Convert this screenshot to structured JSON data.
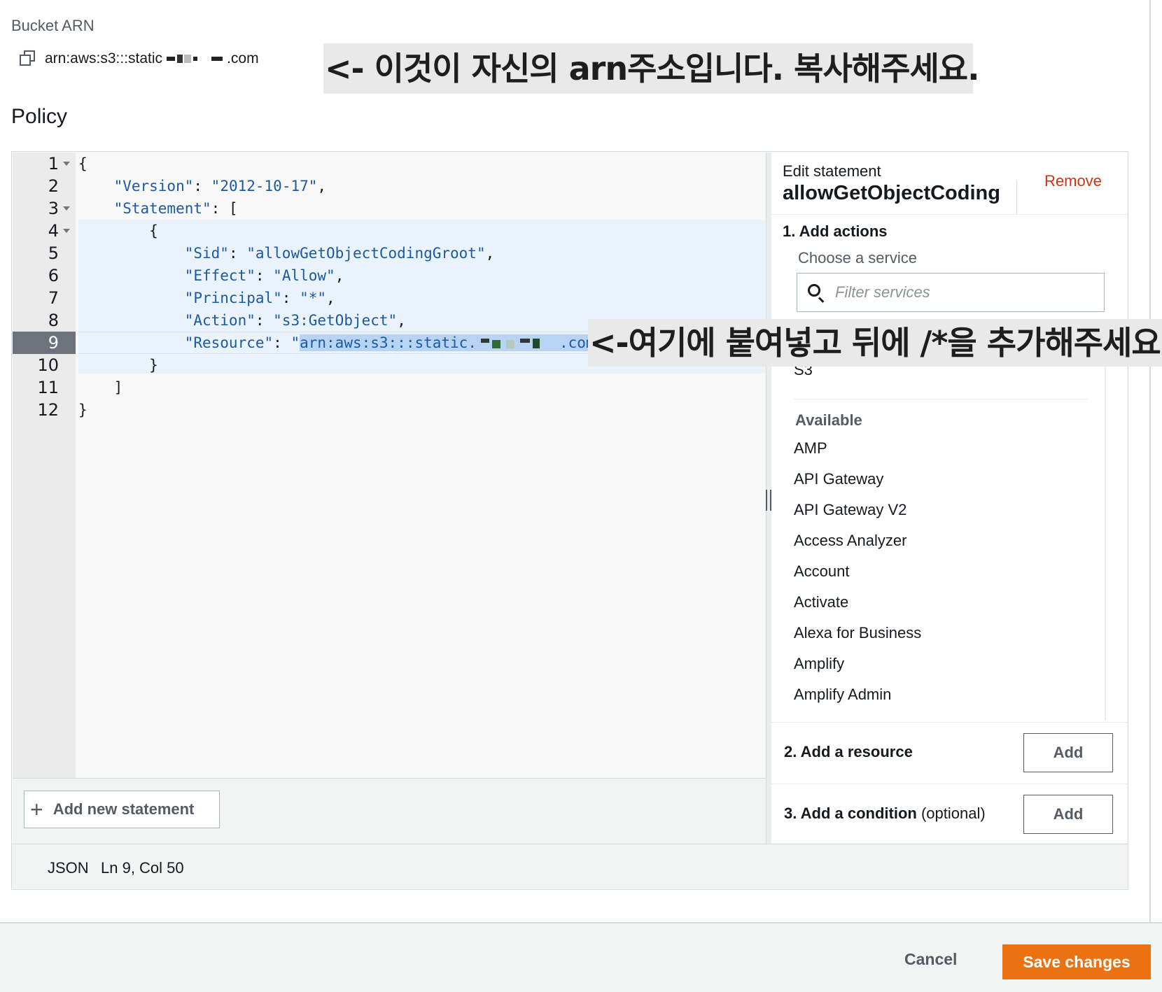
{
  "bucket_arn": {
    "label": "Bucket ARN",
    "value_prefix": "arn:aws:s3:::static",
    "value_suffix": ".com"
  },
  "annotations": {
    "copy_hint": "<- 이것이 자신의 arn주소입니다. 복사해주세요.",
    "paste_hint": "<-여기에 붙여넣고 뒤에 /*을 추가해주세요"
  },
  "policy": {
    "title": "Policy",
    "line_numbers": [
      "1",
      "2",
      "3",
      "4",
      "5",
      "6",
      "7",
      "8",
      "9",
      "10",
      "11",
      "12"
    ],
    "code": {
      "l1": "{",
      "l2_key": "\"Version\"",
      "l2_val": "\"2012-10-17\"",
      "l3_key": "\"Statement\"",
      "l3_rest": "[",
      "l4": "{",
      "l5_key": "\"Sid\"",
      "l5_val": "\"allowGetObjectCodingGroot\"",
      "l6_key": "\"Effect\"",
      "l6_val": "\"Allow\"",
      "l7_key": "\"Principal\"",
      "l7_val": "\"*\"",
      "l8_key": "\"Action\"",
      "l8_val": "\"s3:GetObject\"",
      "l9_key": "\"Resource\"",
      "l9_quote": "\"",
      "l9_selected_prefix": "arn:aws:s3:::static.",
      "l9_selected_suffix": ".com",
      "l9_tail": "/*\"",
      "l10": "}",
      "l11": "]",
      "l12": "}"
    },
    "add_statement_label": "Add new statement"
  },
  "side_panel": {
    "edit_statement_label": "Edit statement",
    "statement_name": "allowGetObjectCoding",
    "remove_label": "Remove",
    "step1_label": "1. Add actions",
    "choose_service_label": "Choose a service",
    "filter_placeholder": "Filter services",
    "selected_service_partial": "S3",
    "available_header": "Available",
    "services": [
      "AMP",
      "API Gateway",
      "API Gateway V2",
      "Access Analyzer",
      "Account",
      "Activate",
      "Alexa for Business",
      "Amplify",
      "Amplify Admin"
    ],
    "step2_label": "2. Add a resource",
    "step2_button": "Add",
    "step3_label_bold": "3. Add a condition",
    "step3_label_optional": " (optional)",
    "step3_button": "Add"
  },
  "status_bar": {
    "language": "JSON",
    "position": "Ln 9, Col 50"
  },
  "footer": {
    "cancel_label": "Cancel",
    "save_label": "Save changes"
  },
  "colors": {
    "primary_button": "#ec7211",
    "remove_link": "#d13212",
    "json_string": "#1a5aa3",
    "selection": "#b9d4f3"
  }
}
